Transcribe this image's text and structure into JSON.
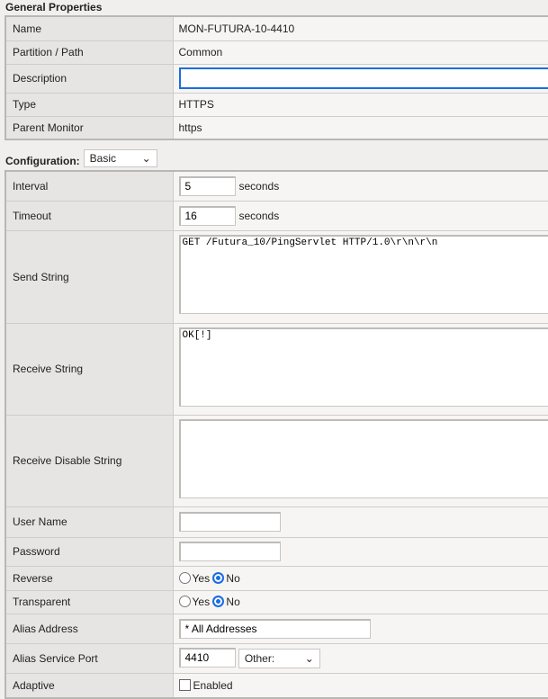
{
  "general": {
    "title": "General Properties",
    "name_label": "Name",
    "name": "MON-FUTURA-10-4410",
    "partition_label": "Partition / Path",
    "partition": "Common",
    "description_label": "Description",
    "description": "",
    "type_label": "Type",
    "type": "HTTPS",
    "parent_label": "Parent Monitor",
    "parent": "https"
  },
  "config": {
    "label": "Configuration:",
    "mode": "Basic",
    "interval_label": "Interval",
    "interval": "5",
    "interval_unit": "seconds",
    "timeout_label": "Timeout",
    "timeout": "16",
    "timeout_unit": "seconds",
    "send_label": "Send String",
    "send": "GET /Futura_10/PingServlet HTTP/1.0\\r\\n\\r\\n",
    "receive_label": "Receive String",
    "receive": "OK[!]",
    "receive_disable_label": "Receive Disable String",
    "receive_disable": "",
    "username_label": "User Name",
    "username": "",
    "password_label": "Password",
    "password": "",
    "reverse_label": "Reverse",
    "transparent_label": "Transparent",
    "yes": "Yes",
    "no": "No",
    "reverse_value": "No",
    "transparent_value": "No",
    "alias_address_label": "Alias Address",
    "alias_address": "* All Addresses",
    "alias_port_label": "Alias Service Port",
    "alias_port": "4410",
    "alias_port_select": "Other:",
    "adaptive_label": "Adaptive",
    "adaptive_option": "Enabled",
    "adaptive_checked": false
  }
}
